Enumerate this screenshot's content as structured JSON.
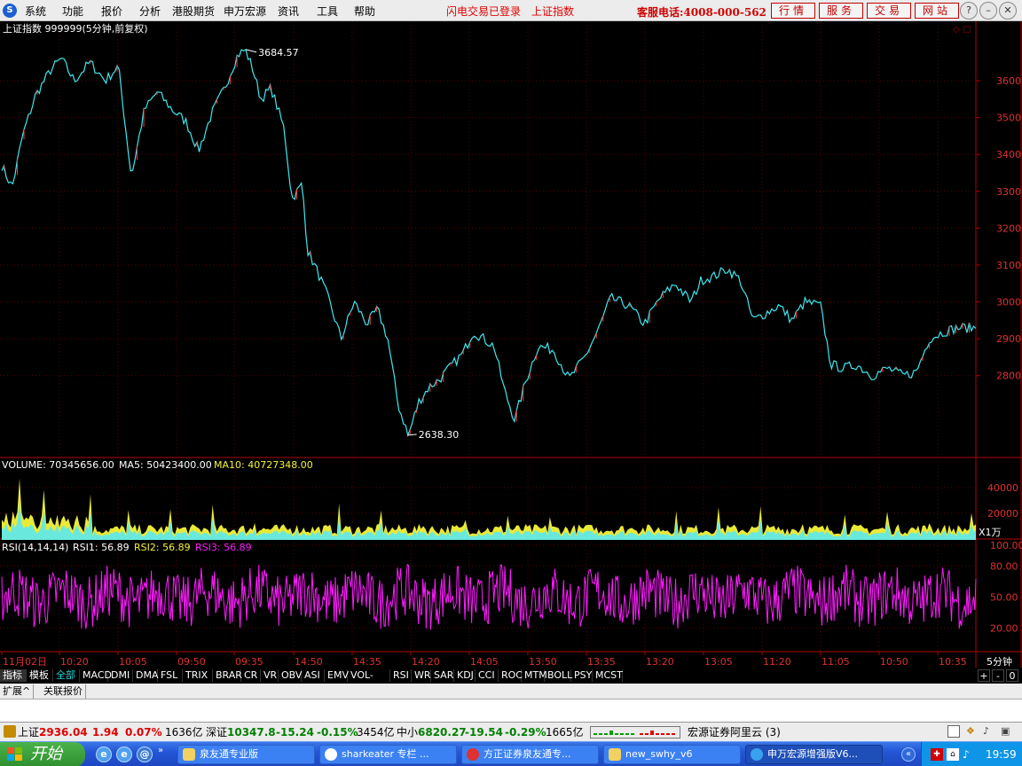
{
  "app": {
    "logo": "S",
    "menu": [
      "系统",
      "功能",
      "报价",
      "分析",
      "港股期货",
      "申万宏源",
      "资讯",
      "工具",
      "帮助"
    ],
    "notice_login": "闪电交易已登录",
    "notice_index": "上证指数",
    "service_phone": "客服电话:4008-000-562",
    "right_buttons": [
      "行情",
      "服务",
      "交易",
      "网站"
    ],
    "window_controls": [
      "?",
      "minimize",
      "restore",
      "close"
    ]
  },
  "chart_data": {
    "type": "line",
    "title": "上证指数 999999(5分钟,前复权)",
    "price_axis": {
      "ticks": [
        3600,
        3500,
        3400,
        3300,
        3200,
        3100,
        3000,
        2900,
        2800
      ],
      "ylim": [
        2578,
        3718
      ]
    },
    "price_marks": {
      "high": "3684.57",
      "low": "2638.30"
    },
    "anchors": [
      [
        0,
        3370
      ],
      [
        4,
        3310
      ],
      [
        8,
        3450
      ],
      [
        13,
        3560
      ],
      [
        19,
        3630
      ],
      [
        23,
        3660
      ],
      [
        28,
        3600
      ],
      [
        34,
        3650
      ],
      [
        40,
        3600
      ],
      [
        45,
        3640
      ],
      [
        50,
        3340
      ],
      [
        55,
        3520
      ],
      [
        60,
        3570
      ],
      [
        66,
        3520
      ],
      [
        71,
        3490
      ],
      [
        76,
        3410
      ],
      [
        81,
        3510
      ],
      [
        86,
        3580
      ],
      [
        91,
        3670
      ],
      [
        94,
        3684.57
      ],
      [
        97,
        3630
      ],
      [
        100,
        3550
      ],
      [
        104,
        3580
      ],
      [
        109,
        3470
      ],
      [
        112,
        3280
      ],
      [
        116,
        3320
      ],
      [
        118,
        3140
      ],
      [
        122,
        3080
      ],
      [
        126,
        3010
      ],
      [
        131,
        2900
      ],
      [
        136,
        3000
      ],
      [
        141,
        2940
      ],
      [
        145,
        2980
      ],
      [
        149,
        2900
      ],
      [
        153,
        2720
      ],
      [
        157,
        2638.3
      ],
      [
        161,
        2730
      ],
      [
        165,
        2770
      ],
      [
        169,
        2790
      ],
      [
        174,
        2830
      ],
      [
        178,
        2860
      ],
      [
        182,
        2920
      ],
      [
        186,
        2900
      ],
      [
        190,
        2880
      ],
      [
        194,
        2760
      ],
      [
        198,
        2680
      ],
      [
        202,
        2780
      ],
      [
        207,
        2880
      ],
      [
        213,
        2870
      ],
      [
        219,
        2790
      ],
      [
        225,
        2850
      ],
      [
        230,
        2920
      ],
      [
        235,
        3010
      ],
      [
        242,
        2990
      ],
      [
        248,
        2940
      ],
      [
        254,
        3010
      ],
      [
        260,
        3050
      ],
      [
        266,
        3000
      ],
      [
        270,
        3060
      ],
      [
        275,
        3070
      ],
      [
        280,
        3090
      ],
      [
        285,
        3060
      ],
      [
        290,
        2950
      ],
      [
        295,
        2970
      ],
      [
        300,
        2990
      ],
      [
        305,
        2950
      ],
      [
        310,
        3000
      ],
      [
        316,
        2990
      ],
      [
        320,
        2830
      ],
      [
        325,
        2820
      ],
      [
        330,
        2830
      ],
      [
        336,
        2800
      ],
      [
        342,
        2820
      ],
      [
        348,
        2800
      ],
      [
        353,
        2810
      ],
      [
        358,
        2900
      ],
      [
        364,
        2920
      ],
      [
        369,
        2930
      ],
      [
        376,
        2930
      ]
    ],
    "volume": {
      "label": "VOLUME: 70345656.00",
      "ma5": "MA5: 50423400.00",
      "ma10": "MA10: 40727348.00",
      "ticks": [
        "40000",
        "20000"
      ],
      "unit": "X1万"
    },
    "rsi": {
      "label": "RSI(14,14,14)",
      "rsi1": "RSI1: 56.89",
      "rsi2": "RSI2: 56.89",
      "rsi3": "RSI3: 56.89",
      "ticks": [
        "100.00",
        "80.00",
        "50.00",
        "20.00"
      ]
    },
    "x_labels": [
      "11月02日",
      "10:20",
      "10:05",
      "09:50",
      "09:35",
      "14:50",
      "14:35",
      "14:20",
      "14:05",
      "13:50",
      "13:35",
      "13:20",
      "13:05",
      "11:20",
      "11:05",
      "10:50",
      "10:35"
    ],
    "period": "5分钟",
    "colors": {
      "price": "#3ee8ee",
      "down": "#3ee8ee",
      "up": "#ff3a3a",
      "volume_fill": "#f6f63a",
      "volume_line": "#5be9f0",
      "rsi": "#ff1cff",
      "axis": "#b00000",
      "grid": "#5a0000",
      "label_yellow": "#f3f33c"
    }
  },
  "tabs": [
    "指标",
    "模板",
    "全部",
    "MACD",
    "DMI",
    "DMA",
    "FSL",
    "TRIX",
    "BRAR",
    "CR",
    "VR",
    "OBV",
    "ASI",
    "EMV",
    "VOL-TDX",
    "RSI",
    "WR",
    "SAR",
    "KDJ",
    "CCI",
    "ROC",
    "MTM",
    "BOLL",
    "PSY",
    "MCST"
  ],
  "tab_controls": [
    "+",
    "-",
    "0"
  ],
  "subtabs": [
    "扩展^",
    "关联报价"
  ],
  "status": {
    "sh_name": "上证",
    "sh_price": "2936.04",
    "sh_chg": "1.94",
    "sh_pct": "0.07%",
    "sh_amt": "1636亿",
    "sz_name": "深证",
    "sz_price": "10347.8",
    "sz_chg": "-15.24",
    "sz_pct": "-0.15%",
    "sz_amt": "3454亿",
    "zx_name": "中小",
    "zx_price": "6820.27",
    "zx_chg": "-19.54",
    "zx_pct": "-0.29%",
    "zx_amt": "1665亿",
    "server": "宏源证券阿里云 (3)"
  },
  "taskbar": {
    "start": "开始",
    "quicklaunch": [
      "ie",
      "ie",
      "mail"
    ],
    "items": [
      "泉友通专业版",
      "sharkeater 专栏 ...",
      "方正证券泉友通专...",
      "new_swhy_v6",
      "申万宏源增强版V6..."
    ],
    "clock": "19:59"
  }
}
